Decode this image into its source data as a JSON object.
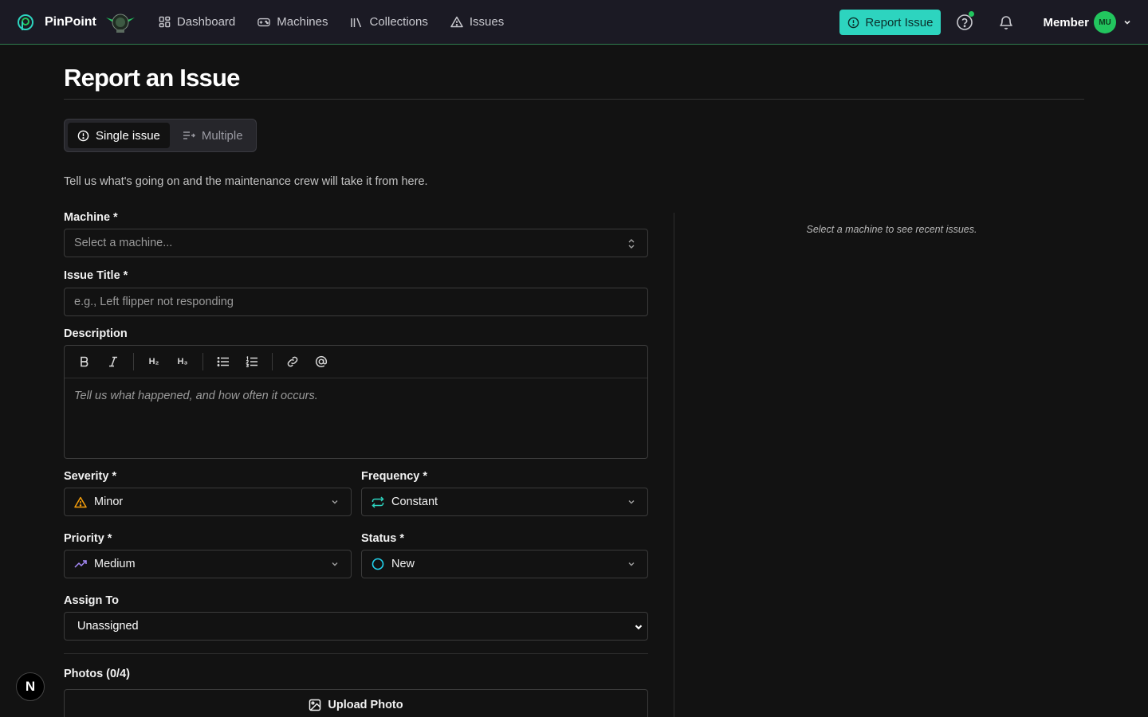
{
  "app": {
    "name": "PinPoint",
    "club_logo_alt": "Austin Pinball Collective"
  },
  "nav": {
    "links": [
      {
        "label": "Dashboard",
        "icon": "dashboard-grid-icon"
      },
      {
        "label": "Machines",
        "icon": "gamepad-icon"
      },
      {
        "label": "Collections",
        "icon": "library-icon"
      },
      {
        "label": "Issues",
        "icon": "alert-triangle-icon"
      }
    ],
    "report_button": "Report Issue",
    "user": {
      "name": "Member",
      "initials": "MU"
    }
  },
  "page": {
    "title": "Report an Issue",
    "modes": {
      "single": "Single issue",
      "multiple": "Multiple"
    },
    "intro": "Tell us what's going on and the maintenance crew will take it from here."
  },
  "form": {
    "machine": {
      "label": "Machine *",
      "placeholder": "Select a machine..."
    },
    "title": {
      "label": "Issue Title *",
      "placeholder": "e.g., Left flipper not responding"
    },
    "description": {
      "label": "Description",
      "placeholder": "Tell us what happened, and how often it occurs.",
      "toolbar": [
        "bold",
        "italic",
        "heading-2",
        "heading-3",
        "bullet-list",
        "ordered-list",
        "link",
        "mention"
      ],
      "h2": "H₂",
      "h3": "H₃"
    },
    "severity": {
      "label": "Severity *",
      "value": "Minor"
    },
    "frequency": {
      "label": "Frequency *",
      "value": "Constant"
    },
    "priority": {
      "label": "Priority *",
      "value": "Medium"
    },
    "status": {
      "label": "Status *",
      "value": "New"
    },
    "assign": {
      "label": "Assign To",
      "value": "Unassigned"
    },
    "photos": {
      "label": "Photos (0/4)",
      "upload": "Upload Photo"
    }
  },
  "sidebar": {
    "hint": "Select a machine to see recent issues."
  },
  "dev_badge": "N",
  "colors": {
    "accent": "#2dd4bf",
    "nav_border": "#2f7d4f",
    "severity_warning": "#f59e0b",
    "frequency_icon": "#2dd4bf",
    "priority_icon": "#a78bfa",
    "status_new": "#22d3ee",
    "online_dot": "#22c55e"
  }
}
